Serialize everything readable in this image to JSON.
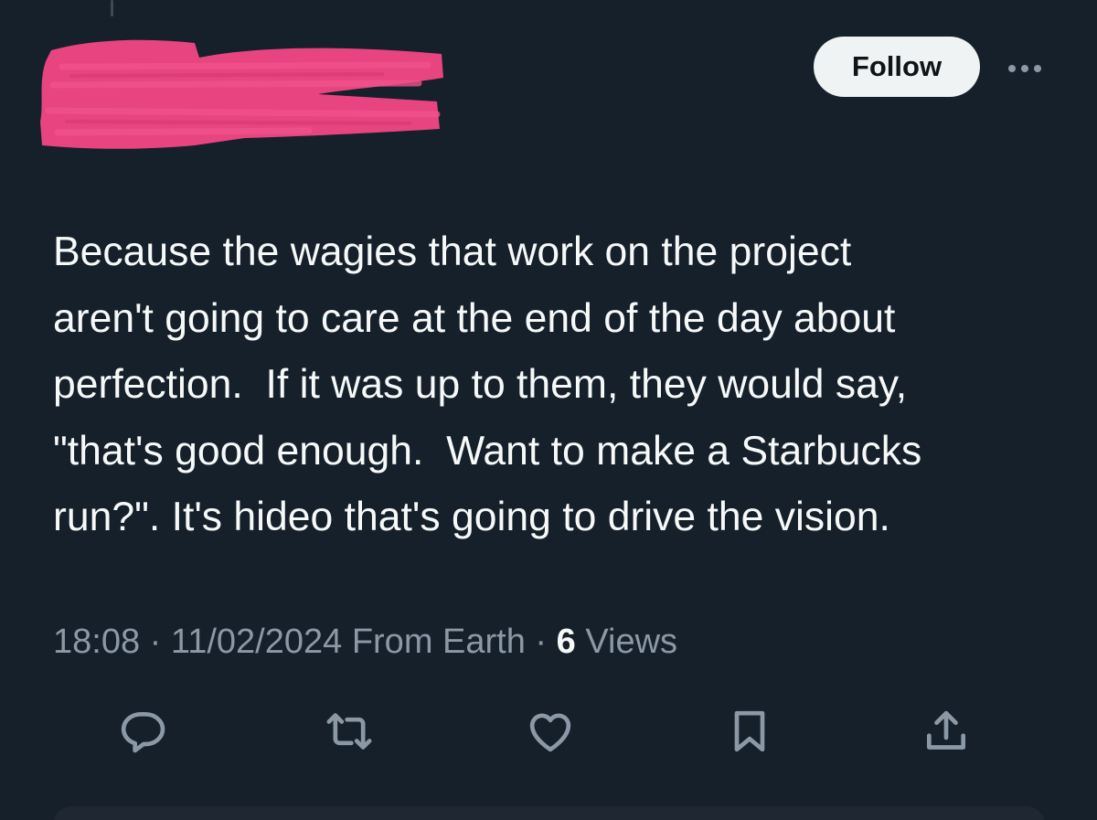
{
  "tweet": {
    "follow_label": "Follow",
    "text": "Because the wagies that work on the project\naren't going to care at the end of the day about\nperfection.  If it was up to them, they would say,\n\"that's good enough.  Want to make a Starbucks\nrun?\". It's hideo that's going to drive the vision.",
    "time": "18:08",
    "date": "11/02/2024",
    "source": "From Earth",
    "views_count": "6",
    "views_label": "Views"
  },
  "icons": {
    "more": "more-dots-icon",
    "reply": "reply-bubble-icon",
    "retweet": "retweet-icon",
    "like": "heart-icon",
    "bookmark": "bookmark-icon",
    "share": "share-icon"
  },
  "colors": {
    "background": "#15202b",
    "text": "#f7f9f9",
    "secondary_text": "#8b98a5",
    "follow_button_bg": "#eff3f4",
    "redaction": "#e8447f"
  }
}
